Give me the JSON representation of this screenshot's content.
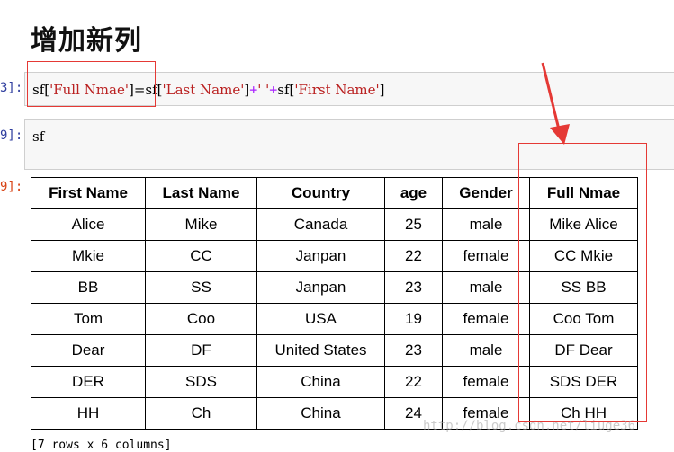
{
  "heading": "增加新列",
  "cells": [
    {
      "prompt": "3]:",
      "code": {
        "part1": "sf[",
        "str1": "'Full Nmae'",
        "part2": "]=sf[",
        "str2": "'Last Name'",
        "part3": "]",
        "op1": "+",
        "str3": "' '",
        "op2": "+",
        "part4": "sf[",
        "str4": "'First Name'",
        "part5": "]"
      }
    },
    {
      "prompt": "9]:",
      "code_text": "sf"
    },
    {
      "prompt": "9]:"
    }
  ],
  "table": {
    "columns": [
      "First Name",
      "Last Name",
      "Country",
      "age",
      "Gender",
      "Full Nmae"
    ],
    "rows": [
      [
        "Alice",
        "Mike",
        "Canada",
        "25",
        "male",
        "Mike Alice"
      ],
      [
        "Mkie",
        "CC",
        "Janpan",
        "22",
        "female",
        "CC Mkie"
      ],
      [
        "BB",
        "SS",
        "Janpan",
        "23",
        "male",
        "SS BB"
      ],
      [
        "Tom",
        "Coo",
        "USA",
        "19",
        "female",
        "Coo Tom"
      ],
      [
        "Dear",
        "DF",
        "United States",
        "23",
        "male",
        "DF Dear"
      ],
      [
        "DER",
        "SDS",
        "China",
        "22",
        "female",
        "SDS DER"
      ],
      [
        "HH",
        "Ch",
        "China",
        "24",
        "female",
        "Ch HH"
      ]
    ]
  },
  "footer_text": "[7 rows x 6 columns]",
  "watermark": "http://blog.csdn.net/liuge36",
  "colors": {
    "annotation": "#e53935",
    "prompt_in": "#303f9f",
    "prompt_out": "#d84315"
  }
}
